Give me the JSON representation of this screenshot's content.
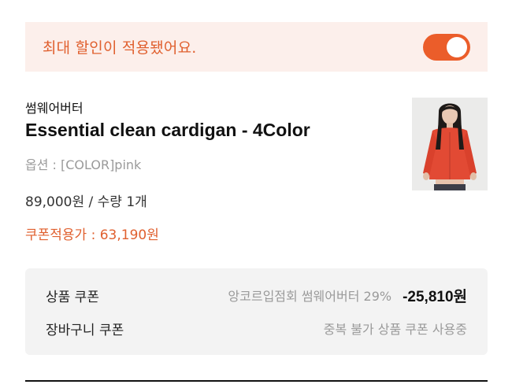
{
  "banner": {
    "message": "최대 할인이 적용됐어요.",
    "toggle_on": true,
    "toggle_color": "#eb5d2a"
  },
  "product": {
    "brand": "썸웨어버터",
    "name": "Essential clean cardigan - 4Color",
    "option": "옵션 : [COLOR]pink",
    "price_qty": "89,000원 / 수량 1개",
    "coupon_price": "쿠폰적용가 : 63,190원"
  },
  "coupons": {
    "product_coupon": {
      "label": "상품 쿠폰",
      "description": "앙코르입점회 썸웨어버터 29%",
      "amount": "-25,810원"
    },
    "cart_coupon": {
      "label": "장바구니 쿠폰",
      "description": "중복 불가 상품 쿠폰 사용중"
    }
  },
  "colors": {
    "accent": "#e0602f",
    "banner_bg": "#fcefeb",
    "coupon_box_bg": "#f3f3f3"
  }
}
